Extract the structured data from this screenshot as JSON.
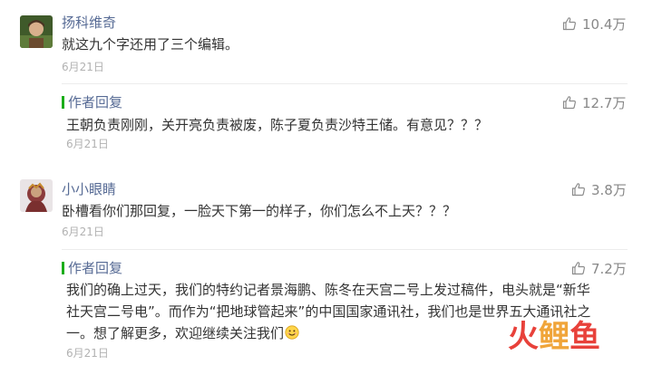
{
  "comments": [
    {
      "name": "扬科维奇",
      "text": "就这九个字还用了三个编辑。",
      "date": "6月21日",
      "likes": "10.4万",
      "reply": {
        "label": "作者回复",
        "text": "王朝负责刚刚，关开亮负责被废，陈子夏负责沙特王储。有意见？？？",
        "date": "6月21日",
        "likes": "12.7万"
      }
    },
    {
      "name": "小小眼睛",
      "text": "卧槽看你们那回复，一脸天下第一的样子，你们怎么不上天？？？",
      "date": "6月21日",
      "likes": "3.8万",
      "reply": {
        "label": "作者回复",
        "lines": [
          "我们的确上过天，我们的特约记者景海鹏、陈冬在天宫二号上发过稿件，电头就是“新华",
          "社天宫二号电”。而作为“把地球管起来”的中国国家通讯社，我们也是世界五大通讯社之",
          "一。想了解更多，欢迎继续关注我们"
        ],
        "date": "6月21日",
        "likes": "7.2万"
      }
    }
  ],
  "watermark": {
    "chars": [
      "火",
      "鲤",
      "鱼"
    ],
    "colors": [
      "#e8413a",
      "#f0a53a",
      "#e8413a"
    ]
  },
  "colors": {
    "name": "#576b95",
    "text": "#333333",
    "date": "#b2b2b2",
    "like": "#888888",
    "author_bar": "#1aad19"
  },
  "icons": {
    "like": "thumbs-up-icon",
    "emoji": "smile-emoji-icon"
  }
}
